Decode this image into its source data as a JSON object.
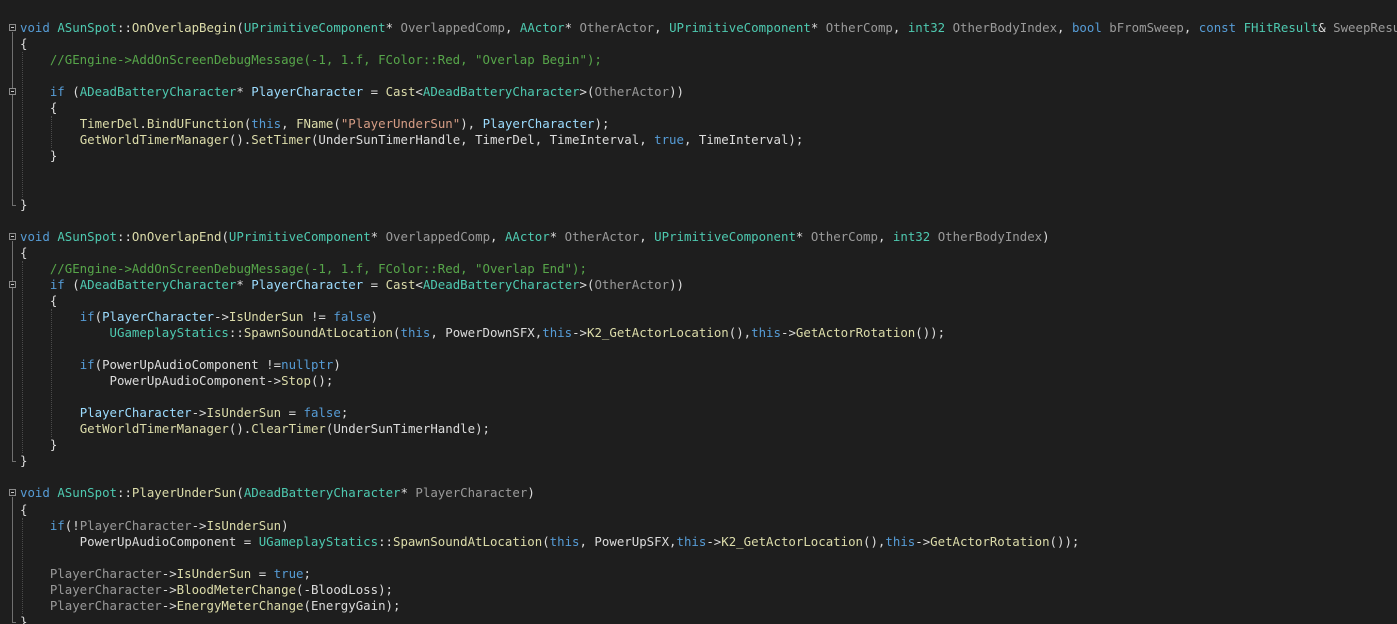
{
  "editor": {
    "colors": {
      "background": "#1e1e1e",
      "keyword": "#569cd6",
      "type": "#4ec9b0",
      "function": "#dcdcaa",
      "variable": "#9cdcfe",
      "string": "#d69d85",
      "number": "#b5cea8",
      "comment": "#57a64a",
      "parameter": "#9a9a9a",
      "plain": "#dcdcdc"
    },
    "fold_icon": "collapse-minus-icon",
    "lines": [
      {
        "fold": true,
        "tokens": [
          {
            "t": "kw",
            "v": "void"
          },
          {
            "t": "pln",
            "v": " "
          },
          {
            "t": "cls",
            "v": "ASunSpot"
          },
          {
            "t": "pln",
            "v": "::"
          },
          {
            "t": "fn",
            "v": "OnOverlapBegin"
          },
          {
            "t": "pln",
            "v": "("
          },
          {
            "t": "cls",
            "v": "UPrimitiveComponent"
          },
          {
            "t": "pln",
            "v": "* "
          },
          {
            "t": "par",
            "v": "OverlappedComp"
          },
          {
            "t": "pln",
            "v": ", "
          },
          {
            "t": "cls",
            "v": "AActor"
          },
          {
            "t": "pln",
            "v": "* "
          },
          {
            "t": "par",
            "v": "OtherActor"
          },
          {
            "t": "pln",
            "v": ", "
          },
          {
            "t": "cls",
            "v": "UPrimitiveComponent"
          },
          {
            "t": "pln",
            "v": "* "
          },
          {
            "t": "par",
            "v": "OtherComp"
          },
          {
            "t": "pln",
            "v": ", "
          },
          {
            "t": "type",
            "v": "int32"
          },
          {
            "t": "pln",
            "v": " "
          },
          {
            "t": "par",
            "v": "OtherBodyIndex"
          },
          {
            "t": "pln",
            "v": ", "
          },
          {
            "t": "kw",
            "v": "bool"
          },
          {
            "t": "pln",
            "v": " "
          },
          {
            "t": "par",
            "v": "bFromSweep"
          },
          {
            "t": "pln",
            "v": ", "
          },
          {
            "t": "kw",
            "v": "const"
          },
          {
            "t": "pln",
            "v": " "
          },
          {
            "t": "cls",
            "v": "FHitResult"
          },
          {
            "t": "pln",
            "v": "& "
          },
          {
            "t": "par",
            "v": "SweepResult"
          },
          {
            "t": "pln",
            "v": ")"
          }
        ]
      },
      {
        "fold": false,
        "tokens": [
          {
            "t": "pln",
            "v": "{"
          }
        ]
      },
      {
        "fold": false,
        "tokens": [
          {
            "t": "pln",
            "v": "    "
          },
          {
            "t": "com",
            "v": "//GEngine->AddOnScreenDebugMessage(-1, 1.f, FColor::Red, \"Overlap Begin\");"
          }
        ]
      },
      {
        "fold": false,
        "tokens": []
      },
      {
        "fold": true,
        "tokens": [
          {
            "t": "pln",
            "v": "    "
          },
          {
            "t": "kw",
            "v": "if"
          },
          {
            "t": "pln",
            "v": " ("
          },
          {
            "t": "cls",
            "v": "ADeadBatteryCharacter"
          },
          {
            "t": "pln",
            "v": "* "
          },
          {
            "t": "var",
            "v": "PlayerCharacter"
          },
          {
            "t": "pln",
            "v": " = "
          },
          {
            "t": "fn",
            "v": "Cast"
          },
          {
            "t": "pln",
            "v": "<"
          },
          {
            "t": "cls",
            "v": "ADeadBatteryCharacter"
          },
          {
            "t": "pln",
            "v": ">("
          },
          {
            "t": "par",
            "v": "OtherActor"
          },
          {
            "t": "pln",
            "v": "))"
          }
        ]
      },
      {
        "fold": false,
        "tokens": [
          {
            "t": "pln",
            "v": "    {"
          }
        ]
      },
      {
        "fold": false,
        "tokens": [
          {
            "t": "pln",
            "v": "        "
          },
          {
            "t": "fn",
            "v": "TimerDel"
          },
          {
            "t": "pln",
            "v": "."
          },
          {
            "t": "fn",
            "v": "BindUFunction"
          },
          {
            "t": "pln",
            "v": "("
          },
          {
            "t": "kw",
            "v": "this"
          },
          {
            "t": "pln",
            "v": ", "
          },
          {
            "t": "fn",
            "v": "FName"
          },
          {
            "t": "pln",
            "v": "("
          },
          {
            "t": "str",
            "v": "\"PlayerUnderSun\""
          },
          {
            "t": "pln",
            "v": "), "
          },
          {
            "t": "var",
            "v": "PlayerCharacter"
          },
          {
            "t": "pln",
            "v": ");"
          }
        ]
      },
      {
        "fold": false,
        "tokens": [
          {
            "t": "pln",
            "v": "        "
          },
          {
            "t": "fn",
            "v": "GetWorldTimerManager"
          },
          {
            "t": "pln",
            "v": "()."
          },
          {
            "t": "fn",
            "v": "SetTimer"
          },
          {
            "t": "pln",
            "v": "(UnderSunTimerHandle, TimerDel, TimeInterval, "
          },
          {
            "t": "kw",
            "v": "true"
          },
          {
            "t": "pln",
            "v": ", TimeInterval);"
          }
        ]
      },
      {
        "fold": false,
        "tokens": [
          {
            "t": "pln",
            "v": "    }"
          }
        ]
      },
      {
        "fold": false,
        "tokens": []
      },
      {
        "fold": false,
        "tokens": []
      },
      {
        "fold": false,
        "tokens": [
          {
            "t": "pln",
            "v": "}"
          }
        ]
      },
      {
        "fold": false,
        "tokens": []
      },
      {
        "fold": true,
        "tokens": [
          {
            "t": "kw",
            "v": "void"
          },
          {
            "t": "pln",
            "v": " "
          },
          {
            "t": "cls",
            "v": "ASunSpot"
          },
          {
            "t": "pln",
            "v": "::"
          },
          {
            "t": "fn",
            "v": "OnOverlapEnd"
          },
          {
            "t": "pln",
            "v": "("
          },
          {
            "t": "cls",
            "v": "UPrimitiveComponent"
          },
          {
            "t": "pln",
            "v": "* "
          },
          {
            "t": "par",
            "v": "OverlappedComp"
          },
          {
            "t": "pln",
            "v": ", "
          },
          {
            "t": "cls",
            "v": "AActor"
          },
          {
            "t": "pln",
            "v": "* "
          },
          {
            "t": "par",
            "v": "OtherActor"
          },
          {
            "t": "pln",
            "v": ", "
          },
          {
            "t": "cls",
            "v": "UPrimitiveComponent"
          },
          {
            "t": "pln",
            "v": "* "
          },
          {
            "t": "par",
            "v": "OtherComp"
          },
          {
            "t": "pln",
            "v": ", "
          },
          {
            "t": "type",
            "v": "int32"
          },
          {
            "t": "pln",
            "v": " "
          },
          {
            "t": "par",
            "v": "OtherBodyIndex"
          },
          {
            "t": "pln",
            "v": ")"
          }
        ]
      },
      {
        "fold": false,
        "tokens": [
          {
            "t": "pln",
            "v": "{"
          }
        ]
      },
      {
        "fold": false,
        "tokens": [
          {
            "t": "pln",
            "v": "    "
          },
          {
            "t": "com",
            "v": "//GEngine->AddOnScreenDebugMessage(-1, 1.f, FColor::Red, \"Overlap End\");"
          }
        ]
      },
      {
        "fold": true,
        "tokens": [
          {
            "t": "pln",
            "v": "    "
          },
          {
            "t": "kw",
            "v": "if"
          },
          {
            "t": "pln",
            "v": " ("
          },
          {
            "t": "cls",
            "v": "ADeadBatteryCharacter"
          },
          {
            "t": "pln",
            "v": "* "
          },
          {
            "t": "var",
            "v": "PlayerCharacter"
          },
          {
            "t": "pln",
            "v": " = "
          },
          {
            "t": "fn",
            "v": "Cast"
          },
          {
            "t": "pln",
            "v": "<"
          },
          {
            "t": "cls",
            "v": "ADeadBatteryCharacter"
          },
          {
            "t": "pln",
            "v": ">("
          },
          {
            "t": "par",
            "v": "OtherActor"
          },
          {
            "t": "pln",
            "v": "))"
          }
        ]
      },
      {
        "fold": false,
        "tokens": [
          {
            "t": "pln",
            "v": "    {"
          }
        ]
      },
      {
        "fold": false,
        "tokens": [
          {
            "t": "pln",
            "v": "        "
          },
          {
            "t": "kw",
            "v": "if"
          },
          {
            "t": "pln",
            "v": "("
          },
          {
            "t": "var",
            "v": "PlayerCharacter"
          },
          {
            "t": "pln",
            "v": "->"
          },
          {
            "t": "fn",
            "v": "IsUnderSun"
          },
          {
            "t": "pln",
            "v": " != "
          },
          {
            "t": "kw",
            "v": "false"
          },
          {
            "t": "pln",
            "v": ")"
          }
        ]
      },
      {
        "fold": false,
        "tokens": [
          {
            "t": "pln",
            "v": "            "
          },
          {
            "t": "cls",
            "v": "UGameplayStatics"
          },
          {
            "t": "pln",
            "v": "::"
          },
          {
            "t": "fn",
            "v": "SpawnSoundAtLocation"
          },
          {
            "t": "pln",
            "v": "("
          },
          {
            "t": "kw",
            "v": "this"
          },
          {
            "t": "pln",
            "v": ", PowerDownSFX,"
          },
          {
            "t": "kw",
            "v": "this"
          },
          {
            "t": "pln",
            "v": "->"
          },
          {
            "t": "fn",
            "v": "K2_GetActorLocation"
          },
          {
            "t": "pln",
            "v": "(),"
          },
          {
            "t": "kw",
            "v": "this"
          },
          {
            "t": "pln",
            "v": "->"
          },
          {
            "t": "fn",
            "v": "GetActorRotation"
          },
          {
            "t": "pln",
            "v": "());"
          }
        ]
      },
      {
        "fold": false,
        "tokens": []
      },
      {
        "fold": false,
        "tokens": [
          {
            "t": "pln",
            "v": "        "
          },
          {
            "t": "kw",
            "v": "if"
          },
          {
            "t": "pln",
            "v": "(PowerUpAudioComponent !="
          },
          {
            "t": "kw",
            "v": "nullptr"
          },
          {
            "t": "pln",
            "v": ")"
          }
        ]
      },
      {
        "fold": false,
        "tokens": [
          {
            "t": "pln",
            "v": "            PowerUpAudioComponent->"
          },
          {
            "t": "fn",
            "v": "Stop"
          },
          {
            "t": "pln",
            "v": "();"
          }
        ]
      },
      {
        "fold": false,
        "tokens": []
      },
      {
        "fold": false,
        "tokens": [
          {
            "t": "pln",
            "v": "        "
          },
          {
            "t": "var",
            "v": "PlayerCharacter"
          },
          {
            "t": "pln",
            "v": "->"
          },
          {
            "t": "fn",
            "v": "IsUnderSun"
          },
          {
            "t": "pln",
            "v": " = "
          },
          {
            "t": "kw",
            "v": "false"
          },
          {
            "t": "pln",
            "v": ";"
          }
        ]
      },
      {
        "fold": false,
        "tokens": [
          {
            "t": "pln",
            "v": "        "
          },
          {
            "t": "fn",
            "v": "GetWorldTimerManager"
          },
          {
            "t": "pln",
            "v": "()."
          },
          {
            "t": "fn",
            "v": "ClearTimer"
          },
          {
            "t": "pln",
            "v": "(UnderSunTimerHandle);"
          }
        ]
      },
      {
        "fold": false,
        "tokens": [
          {
            "t": "pln",
            "v": "    }"
          }
        ]
      },
      {
        "fold": false,
        "tokens": [
          {
            "t": "pln",
            "v": "}"
          }
        ]
      },
      {
        "fold": false,
        "tokens": []
      },
      {
        "fold": true,
        "tokens": [
          {
            "t": "kw",
            "v": "void"
          },
          {
            "t": "pln",
            "v": " "
          },
          {
            "t": "cls",
            "v": "ASunSpot"
          },
          {
            "t": "pln",
            "v": "::"
          },
          {
            "t": "fn",
            "v": "PlayerUnderSun"
          },
          {
            "t": "pln",
            "v": "("
          },
          {
            "t": "cls",
            "v": "ADeadBatteryCharacter"
          },
          {
            "t": "pln",
            "v": "* "
          },
          {
            "t": "par",
            "v": "PlayerCharacter"
          },
          {
            "t": "pln",
            "v": ")"
          }
        ]
      },
      {
        "fold": false,
        "tokens": [
          {
            "t": "pln",
            "v": "{"
          }
        ]
      },
      {
        "fold": false,
        "tokens": [
          {
            "t": "pln",
            "v": "    "
          },
          {
            "t": "kw",
            "v": "if"
          },
          {
            "t": "pln",
            "v": "(!"
          },
          {
            "t": "par",
            "v": "PlayerCharacter"
          },
          {
            "t": "pln",
            "v": "->"
          },
          {
            "t": "fn",
            "v": "IsUnderSun"
          },
          {
            "t": "pln",
            "v": ")"
          }
        ]
      },
      {
        "fold": false,
        "tokens": [
          {
            "t": "pln",
            "v": "        PowerUpAudioComponent = "
          },
          {
            "t": "cls",
            "v": "UGameplayStatics"
          },
          {
            "t": "pln",
            "v": "::"
          },
          {
            "t": "fn",
            "v": "SpawnSoundAtLocation"
          },
          {
            "t": "pln",
            "v": "("
          },
          {
            "t": "kw",
            "v": "this"
          },
          {
            "t": "pln",
            "v": ", PowerUpSFX,"
          },
          {
            "t": "kw",
            "v": "this"
          },
          {
            "t": "pln",
            "v": "->"
          },
          {
            "t": "fn",
            "v": "K2_GetActorLocation"
          },
          {
            "t": "pln",
            "v": "(),"
          },
          {
            "t": "kw",
            "v": "this"
          },
          {
            "t": "pln",
            "v": "->"
          },
          {
            "t": "fn",
            "v": "GetActorRotation"
          },
          {
            "t": "pln",
            "v": "());"
          }
        ]
      },
      {
        "fold": false,
        "tokens": []
      },
      {
        "fold": false,
        "tokens": [
          {
            "t": "pln",
            "v": "    "
          },
          {
            "t": "par",
            "v": "PlayerCharacter"
          },
          {
            "t": "pln",
            "v": "->"
          },
          {
            "t": "fn",
            "v": "IsUnderSun"
          },
          {
            "t": "pln",
            "v": " = "
          },
          {
            "t": "kw",
            "v": "true"
          },
          {
            "t": "pln",
            "v": ";"
          }
        ]
      },
      {
        "fold": false,
        "tokens": [
          {
            "t": "pln",
            "v": "    "
          },
          {
            "t": "par",
            "v": "PlayerCharacter"
          },
          {
            "t": "pln",
            "v": "->"
          },
          {
            "t": "fn",
            "v": "BloodMeterChange"
          },
          {
            "t": "pln",
            "v": "(-BloodLoss);"
          }
        ]
      },
      {
        "fold": false,
        "tokens": [
          {
            "t": "pln",
            "v": "    "
          },
          {
            "t": "par",
            "v": "PlayerCharacter"
          },
          {
            "t": "pln",
            "v": "->"
          },
          {
            "t": "fn",
            "v": "EnergyMeterChange"
          },
          {
            "t": "pln",
            "v": "(EnergyGain);"
          }
        ]
      },
      {
        "fold": false,
        "tokens": [
          {
            "t": "pln",
            "v": "}"
          }
        ]
      }
    ]
  }
}
